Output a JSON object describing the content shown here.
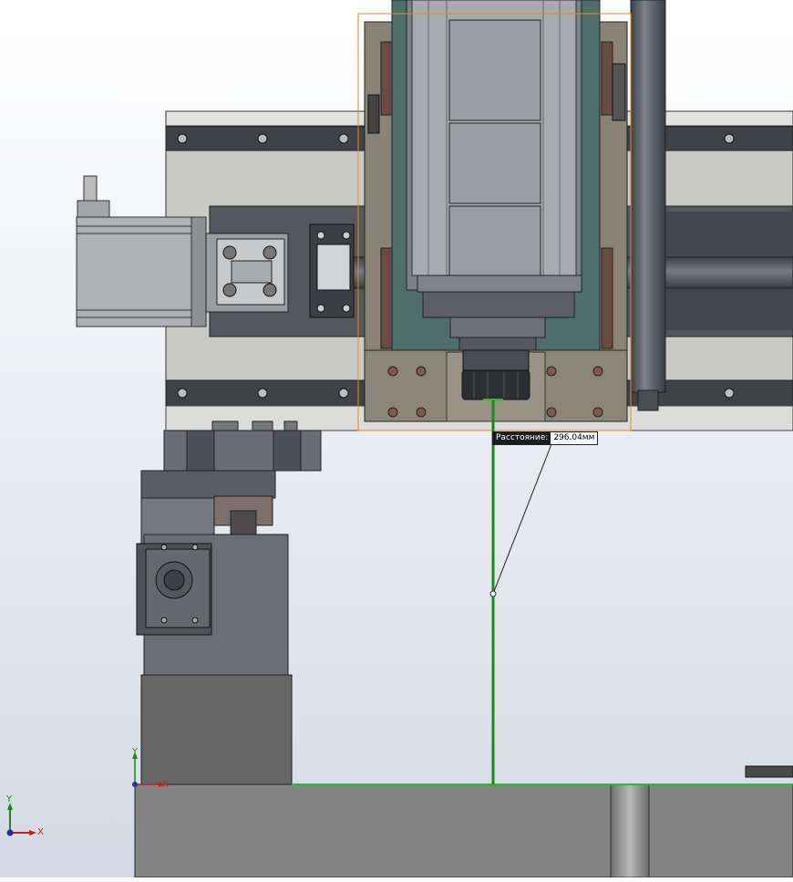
{
  "viewport": {
    "name": "SolidWorks graphics area",
    "background_top": "#ffffff",
    "background_bottom": "#d5dbe6"
  },
  "measurement": {
    "label": "Расстояние:",
    "value": "296.04мм",
    "line_color": "#1a8a1a"
  },
  "origin_triad": {
    "x_label": "X",
    "y_label": "Y"
  },
  "view_triad": {
    "x_label": "X",
    "y_label": "Y"
  },
  "colors": {
    "selection_box": "#e08a2a",
    "plate": "#8a8276",
    "spindle_carriage": "#4f6e6a",
    "metal_dark": "#55585c",
    "metal_mid": "#8c8f93",
    "metal_light": "#c6c8ca",
    "rail": "#3f4247",
    "brake_pads": "#6b4b45"
  }
}
